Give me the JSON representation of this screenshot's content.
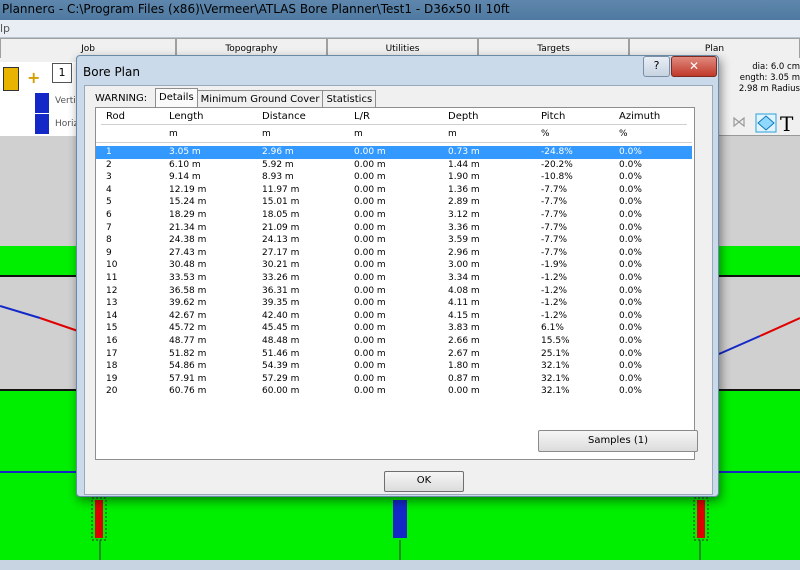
{
  "app": {
    "title": "Plannerɢ - C:\\Program Files (x86)\\Vermeer\\ATLAS Bore Planner\\Test1 - D36x50 II 10ft",
    "menu_partial": "lp",
    "tabs": [
      "Job",
      "Topography",
      "Utilities",
      "Targets",
      "Plan"
    ],
    "rod_count": "1",
    "vertical_label": "Verti",
    "horizontal_label": "Horiz",
    "info_lines": [
      "dia: 6.0 cm",
      "ength: 3.05 m",
      "2.98 m Radius"
    ],
    "colors": {
      "ground": "#00ee00",
      "path_blue": "#1428c8",
      "path_red": "#e00000"
    }
  },
  "dialog": {
    "title": "Bore Plan",
    "help_label": "?",
    "close_label": "✕",
    "warning_label": "WARNING:",
    "tabs": [
      "Details",
      "Minimum Ground Cover",
      "Statistics"
    ],
    "active_tab": "Details",
    "columns": [
      "Rod",
      "Length",
      "Distance",
      "L/R",
      "Depth",
      "Pitch",
      "Azimuth"
    ],
    "units": [
      "",
      "m",
      "m",
      "m",
      "m",
      "%",
      "%"
    ],
    "selected_row": 0,
    "rows": [
      [
        "1",
        "3.05 m",
        "2.96 m",
        "0.00 m",
        "0.73 m",
        "-24.8%",
        "0.0%"
      ],
      [
        "2",
        "6.10 m",
        "5.92 m",
        "0.00 m",
        "1.44 m",
        "-20.2%",
        "0.0%"
      ],
      [
        "3",
        "9.14 m",
        "8.93 m",
        "0.00 m",
        "1.90 m",
        "-10.8%",
        "0.0%"
      ],
      [
        "4",
        "12.19 m",
        "11.97 m",
        "0.00 m",
        "1.36 m",
        "-7.7%",
        "0.0%"
      ],
      [
        "5",
        "15.24 m",
        "15.01 m",
        "0.00 m",
        "2.89 m",
        "-7.7%",
        "0.0%"
      ],
      [
        "6",
        "18.29 m",
        "18.05 m",
        "0.00 m",
        "3.12 m",
        "-7.7%",
        "0.0%"
      ],
      [
        "7",
        "21.34 m",
        "21.09 m",
        "0.00 m",
        "3.36 m",
        "-7.7%",
        "0.0%"
      ],
      [
        "8",
        "24.38 m",
        "24.13 m",
        "0.00 m",
        "3.59 m",
        "-7.7%",
        "0.0%"
      ],
      [
        "9",
        "27.43 m",
        "27.17 m",
        "0.00 m",
        "2.96 m",
        "-7.7%",
        "0.0%"
      ],
      [
        "10",
        "30.48 m",
        "30.21 m",
        "0.00 m",
        "3.00 m",
        "-1.9%",
        "0.0%"
      ],
      [
        "11",
        "33.53 m",
        "33.26 m",
        "0.00 m",
        "3.34 m",
        "-1.2%",
        "0.0%"
      ],
      [
        "12",
        "36.58 m",
        "36.31 m",
        "0.00 m",
        "4.08 m",
        "-1.2%",
        "0.0%"
      ],
      [
        "13",
        "39.62 m",
        "39.35 m",
        "0.00 m",
        "4.11 m",
        "-1.2%",
        "0.0%"
      ],
      [
        "14",
        "42.67 m",
        "42.40 m",
        "0.00 m",
        "4.15 m",
        "-1.2%",
        "0.0%"
      ],
      [
        "15",
        "45.72 m",
        "45.45 m",
        "0.00 m",
        "3.83 m",
        "6.1%",
        "0.0%"
      ],
      [
        "16",
        "48.77 m",
        "48.48 m",
        "0.00 m",
        "2.66 m",
        "15.5%",
        "0.0%"
      ],
      [
        "17",
        "51.82 m",
        "51.46 m",
        "0.00 m",
        "2.67 m",
        "25.1%",
        "0.0%"
      ],
      [
        "18",
        "54.86 m",
        "54.39 m",
        "0.00 m",
        "1.80 m",
        "32.1%",
        "0.0%"
      ],
      [
        "19",
        "57.91 m",
        "57.29 m",
        "0.00 m",
        "0.87 m",
        "32.1%",
        "0.0%"
      ],
      [
        "20",
        "60.76 m",
        "60.00 m",
        "0.00 m",
        "0.00 m",
        "32.1%",
        "0.0%"
      ]
    ],
    "samples_button": "Samples (1)",
    "ok_button": "OK"
  }
}
